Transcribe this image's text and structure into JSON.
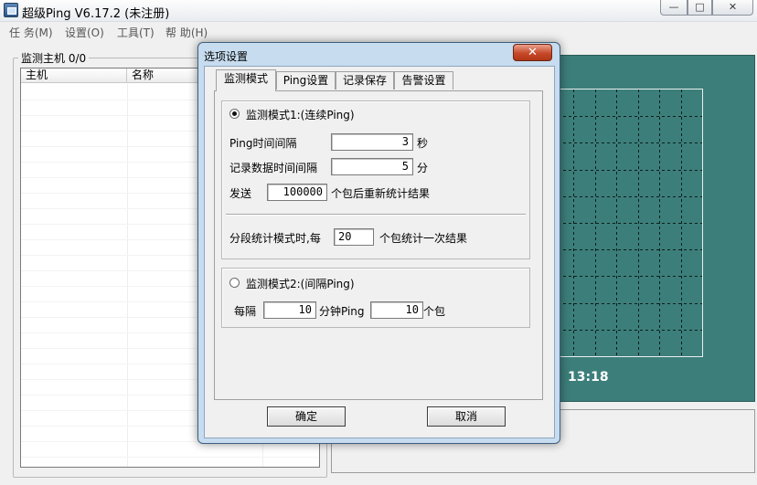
{
  "app": {
    "title": "超级Ping V6.17.2  (未注册)",
    "window_controls": {
      "minimize": "—",
      "maximize": "□",
      "close": "✕"
    }
  },
  "menu": [
    {
      "label": "任 务(M)"
    },
    {
      "label": "设置(O)"
    },
    {
      "label": "工具(T)"
    },
    {
      "label": "帮 助(H)"
    }
  ],
  "hosts_panel": {
    "legend": "监测主机  0/0",
    "columns": [
      "主机",
      "名称"
    ]
  },
  "chart": {
    "time": "13:18",
    "background": "#3c7e7a"
  },
  "dialog": {
    "title": "选项设置",
    "close": "✕",
    "tabs": [
      {
        "label": "监测模式",
        "active": true
      },
      {
        "label": "Ping设置",
        "active": false
      },
      {
        "label": "记录保存",
        "active": false
      },
      {
        "label": "告警设置",
        "active": false
      }
    ],
    "mode1": {
      "label": "监测模式1:(连续Ping)",
      "selected": true,
      "ping_interval": {
        "label": "Ping时间间隔",
        "value": "3",
        "unit": "秒"
      },
      "record_interval": {
        "label": "记录数据时间间隔",
        "value": "5",
        "unit": "分"
      },
      "send": {
        "label": "发送",
        "value": "100000",
        "suffix": "个包后重新统计结果"
      },
      "segment": {
        "label": "分段统计模式时,每",
        "value": "20",
        "suffix": "个包统计一次结果"
      }
    },
    "mode2": {
      "label": "监测模式2:(间隔Ping)",
      "selected": false,
      "every_label": "每隔",
      "minutes_value": "10",
      "minutes_suffix": "分钟Ping",
      "packets_value": "10",
      "packets_suffix": "个包"
    },
    "buttons": {
      "ok": "确定",
      "cancel": "取消"
    }
  }
}
